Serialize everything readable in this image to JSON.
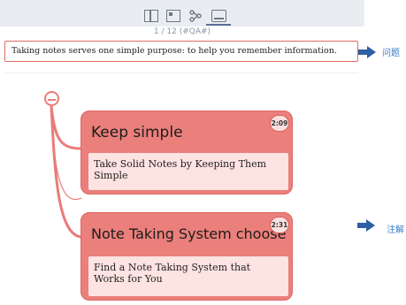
{
  "toolbar": {
    "icons": [
      "book-icon",
      "layout-icon",
      "mindmap-icon",
      "card-icon"
    ],
    "pager": "1 / 12 (#QA#)"
  },
  "question": {
    "text": "Taking notes serves one simple purpose: to help you remember information.",
    "side_label": "问题"
  },
  "answer_side_label": "注解",
  "cards": [
    {
      "title": "Keep simple",
      "timer": "2:09",
      "answer": "Take Solid Notes by Keeping Them Simple"
    },
    {
      "title": "Note Taking System choose",
      "timer": "2:31",
      "answer": "Find a Note Taking System that Works for You"
    }
  ],
  "colors": {
    "card": "#ea7f7b",
    "card_answer_bg": "#fde3e1",
    "accent_blue": "#3b7fc7",
    "question_border": "#e26a66"
  }
}
